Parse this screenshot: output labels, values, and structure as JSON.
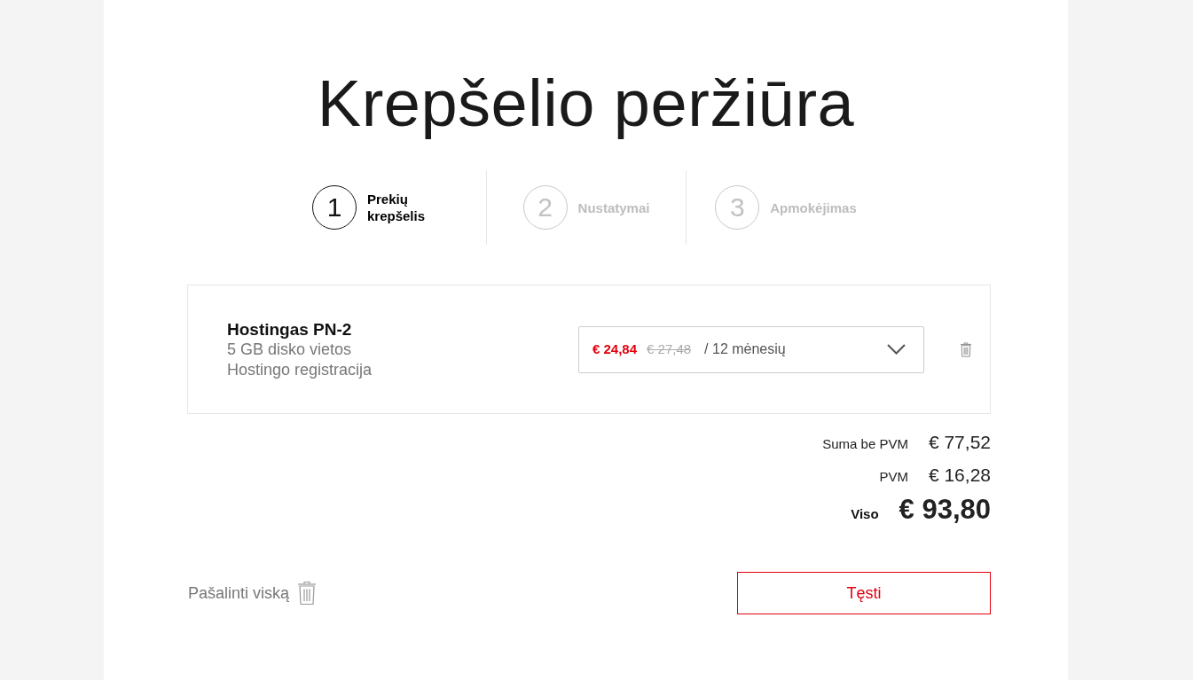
{
  "page": {
    "title": "Krepšelio peržiūra"
  },
  "steps": [
    {
      "number": "1",
      "label": "Prekių krepšelis",
      "selected": true
    },
    {
      "number": "2",
      "label": "Nustatymai",
      "selected": false
    },
    {
      "number": "3",
      "label": "Apmokėjimas",
      "selected": false
    }
  ],
  "cart_items": [
    {
      "name": "Hostingas PN-2",
      "details": [
        "5 GB disko vietos",
        "Hostingo registracija"
      ],
      "period_select": {
        "price": "€ 24,84",
        "old_price": "€ 27,48",
        "period": "/ 12 mėnesių"
      }
    }
  ],
  "totals": [
    {
      "kind": "subtotal",
      "label": "Suma be PVM",
      "value": "€ 77,52"
    },
    {
      "kind": "tax",
      "label": "PVM",
      "value": "€ 16,28"
    },
    {
      "kind": "total",
      "label": "Viso",
      "value": "€ 93,80"
    }
  ],
  "remove_all": {
    "label": "Pašalinti viską"
  },
  "continue_button": {
    "label": "Tęsti"
  }
}
